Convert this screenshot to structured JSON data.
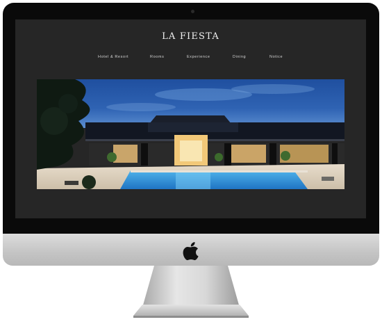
{
  "site": {
    "title": "LA FIESTA",
    "nav": [
      {
        "label": "Hotel & Resort"
      },
      {
        "label": "Rooms"
      },
      {
        "label": "Experience"
      },
      {
        "label": "Dining"
      },
      {
        "label": "Notice"
      }
    ]
  },
  "colors": {
    "bezel": "#0a0a0a",
    "screen_bg": "#262626",
    "sky": "#2c5aa8",
    "pool": "#2f8fd6",
    "aluminum": "#c9c9c9"
  },
  "icons": [
    "apple-logo-icon"
  ]
}
